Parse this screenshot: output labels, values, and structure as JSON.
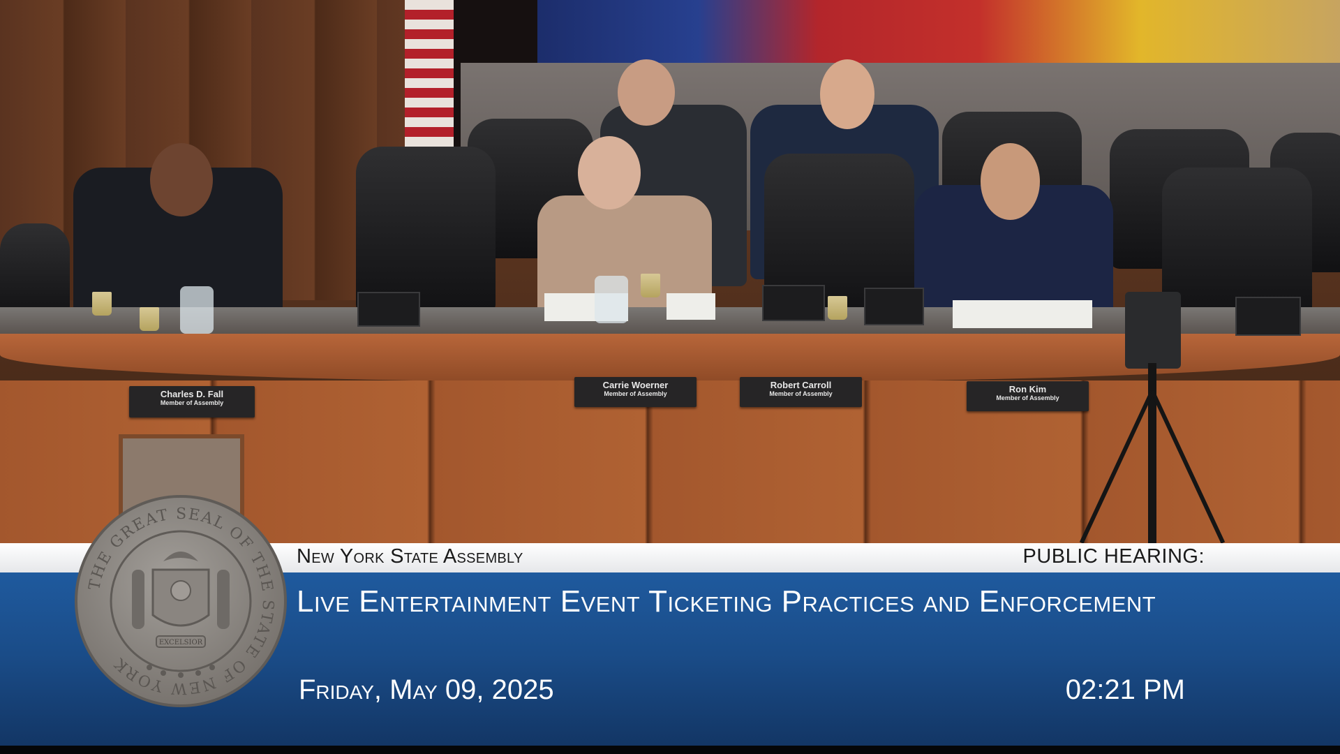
{
  "lower_third": {
    "organization": "New York State Assembly",
    "event_type": "PUBLIC HEARING:",
    "title": "Live Entertainment Event Ticketing Practices and Enforcement",
    "date": "Friday, May 09, 2025",
    "time": "02:21 PM"
  },
  "seal": {
    "ring_text": "THE GREAT SEAL OF THE STATE OF NEW YORK",
    "motto": "EXCELSIOR"
  },
  "nameplates": [
    {
      "name": "Charles D. Fall",
      "role": "Member of Assembly"
    },
    {
      "name": "Carrie Woerner",
      "role": "Member of Assembly"
    },
    {
      "name": "Robert Carroll",
      "role": "Member of Assembly"
    },
    {
      "name": "Ron Kim",
      "role": "Member of Assembly"
    }
  ],
  "colors": {
    "banner_blue": "#1a4c88",
    "banner_white": "#ffffff",
    "seal_gray": "#8e8a86",
    "wood": "#a3572d"
  }
}
